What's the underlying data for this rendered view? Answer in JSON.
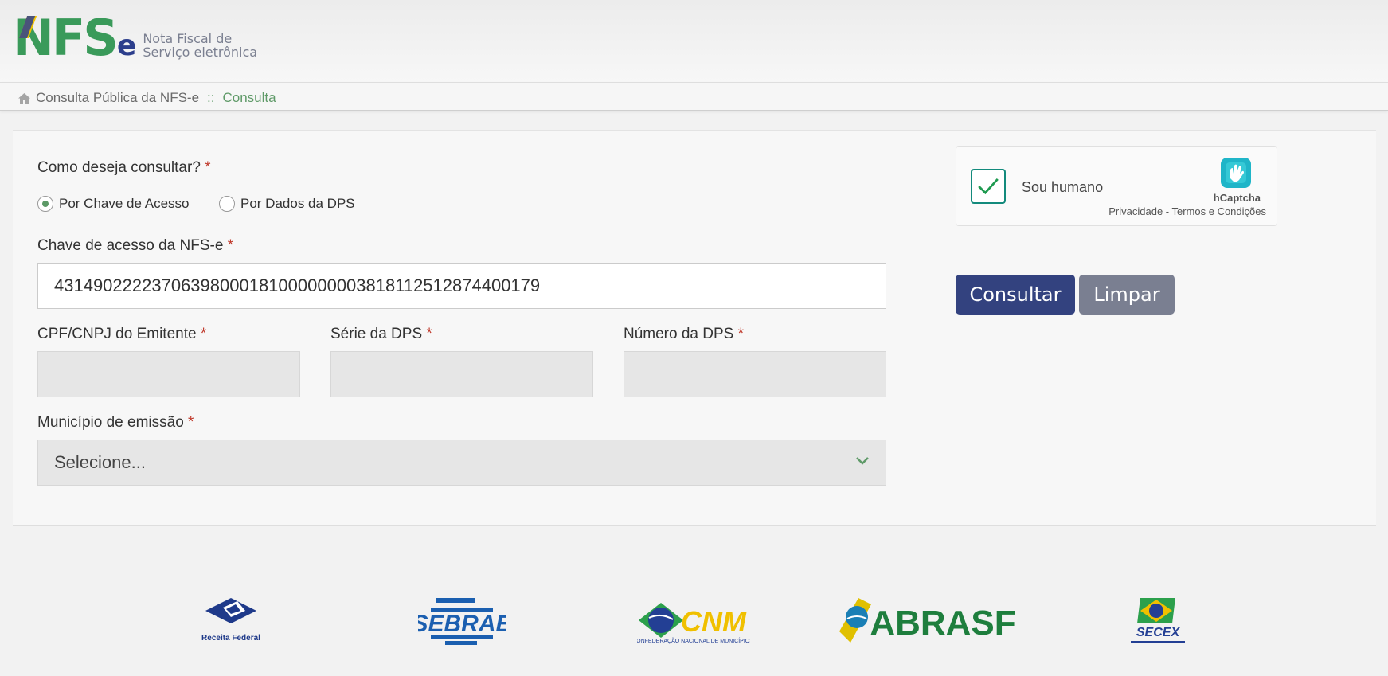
{
  "header": {
    "logo_main": "NFS",
    "logo_e": "e",
    "logo_line1": "Nota Fiscal de",
    "logo_line2": "Serviço eletrônica"
  },
  "breadcrumb": {
    "home_icon": "home-icon",
    "item1": "Consulta Pública da NFS-e",
    "separator": "::",
    "item2": "Consulta"
  },
  "form": {
    "query_label": "Como deseja consultar?",
    "required_mark": "*",
    "radio_options": [
      {
        "label": "Por Chave de Acesso",
        "selected": true
      },
      {
        "label": "Por Dados da DPS",
        "selected": false
      }
    ],
    "key_label": "Chave de acesso da NFS-e",
    "key_value": "43149022223706398000181000000003818112512874400179",
    "cpf_label": "CPF/CNPJ do Emitente",
    "serie_label": "Série da DPS",
    "numero_label": "Número da DPS",
    "municipio_label": "Município de emissão",
    "municipio_value": "Selecione..."
  },
  "captcha": {
    "label": "Sou humano",
    "brand": "hCaptcha",
    "links": "Privacidade - Termos e Condições",
    "checked": true
  },
  "buttons": {
    "submit": "Consultar",
    "clear": "Limpar"
  },
  "footer": {
    "logos": [
      "Receita Federal",
      "SEBRAE",
      "CNM",
      "ABRASF",
      "SECEX"
    ],
    "receita_caption": "Receita Federal",
    "sebrae_text": "SEBRAE",
    "cnm_text": "CNM",
    "cnm_caption": "CONFEDERAÇÃO NACIONAL DE MUNICÍPIOS",
    "abrasf_text": "ABRASF",
    "secex_text": "SECEX"
  },
  "colors": {
    "primary": "#33427f",
    "secondary": "#7a7f91",
    "green": "#5f9a68",
    "required": "#c0392b"
  }
}
